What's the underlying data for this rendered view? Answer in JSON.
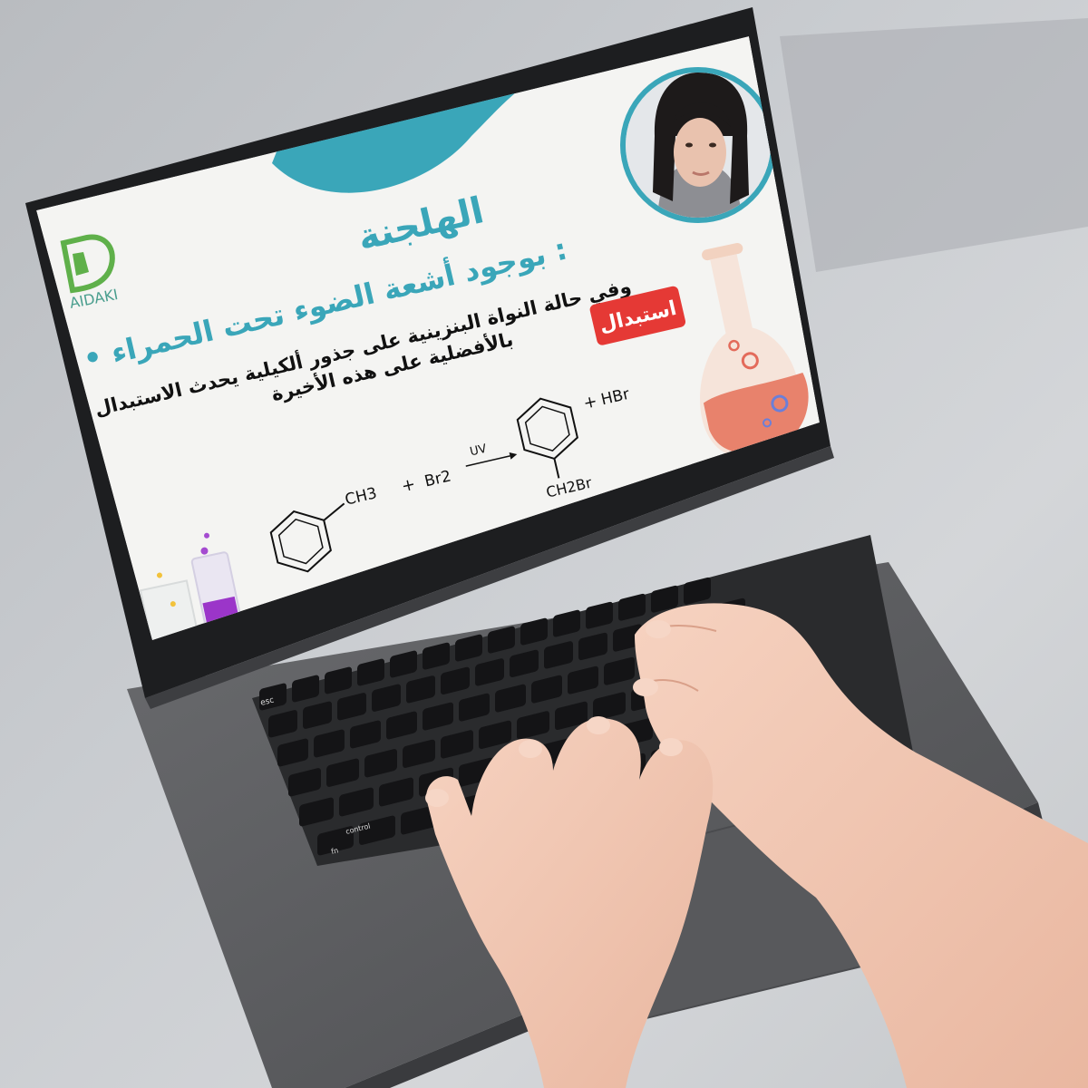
{
  "slide": {
    "logo_text": "AIDAKI",
    "title": "الهلجنة",
    "bullet": "• بوجود أشعة الضوء تحت الحمراء :",
    "body_line1": "وفي حالة النواة البنزينية على جذور ألكيلية يحدث الاستبدال",
    "body_line2": "بالأفضلية على هذه الأخيرة",
    "tag_label": "استبدال",
    "reaction": {
      "reactant_group": "CH3",
      "plus1": "+",
      "reagent": "Br2",
      "condition": "UV",
      "product_group": "CH2Br",
      "plus2": "+",
      "byproduct": "HBr"
    }
  },
  "keyboard": {
    "esc": "esc",
    "control": "control",
    "fn": "fn"
  },
  "colors": {
    "accent_teal": "#3aa6b9",
    "tag_red": "#e53935",
    "laptop_body": "#5a5b5e",
    "keys": "#1c1c1e"
  }
}
